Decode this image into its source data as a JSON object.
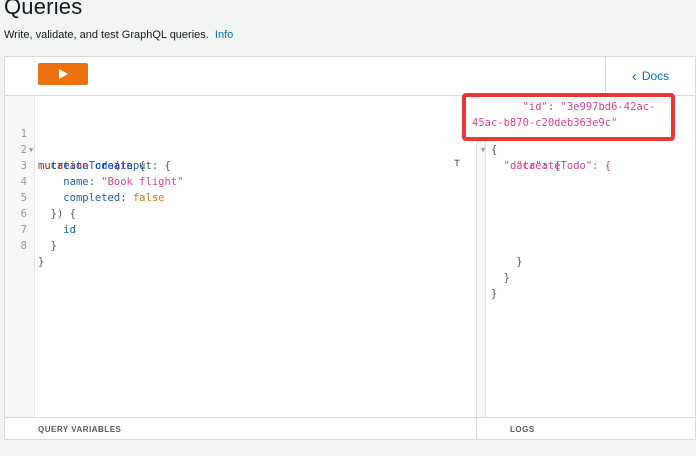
{
  "page": {
    "title": "Queries",
    "subtitle": "Write, validate, and test GraphQL queries.",
    "info_link": "Info"
  },
  "toolbar": {
    "run_icon": "play-icon",
    "docs_label": "Docs",
    "docs_icon": "chevron-left-icon"
  },
  "editor": {
    "line_numbers": [
      "1",
      "2",
      "3",
      "4",
      "5",
      "6",
      "7",
      "8"
    ],
    "lines": {
      "l1": {
        "kw": "mutation",
        "name": "create",
        "rest": " {"
      },
      "l2": {
        "fn": "createTodo",
        "open": "(",
        "arg": "input",
        "rest": ": {"
      },
      "l3": {
        "key": "name",
        "colon": ": ",
        "val": "\"Book flight\""
      },
      "l4": {
        "key": "completed",
        "colon": ": ",
        "val": "false"
      },
      "l5": {
        "text": "}) {"
      },
      "l6": {
        "text": "id"
      },
      "l7": {
        "text": "}"
      },
      "l8": {
        "text": "}"
      }
    }
  },
  "result": {
    "r1": "{",
    "r2_key": "\"data\"",
    "r2_rest": ": {",
    "r3_partial": "\"createTodo\": {",
    "id_key": "\"id\"",
    "id_val_1": "\"3e997bd6-42ac-",
    "id_val_2": "45ac-b870-c20deb363e9c\"",
    "r_close_inner": "}",
    "r_close_mid": "}",
    "r_close_outer": "}"
  },
  "footer": {
    "query_variables": "QUERY VARIABLES",
    "logs": "LOGS"
  },
  "colors": {
    "run_button": "#ec7211",
    "link": "#0073bb",
    "highlight_border": "#e53935"
  }
}
